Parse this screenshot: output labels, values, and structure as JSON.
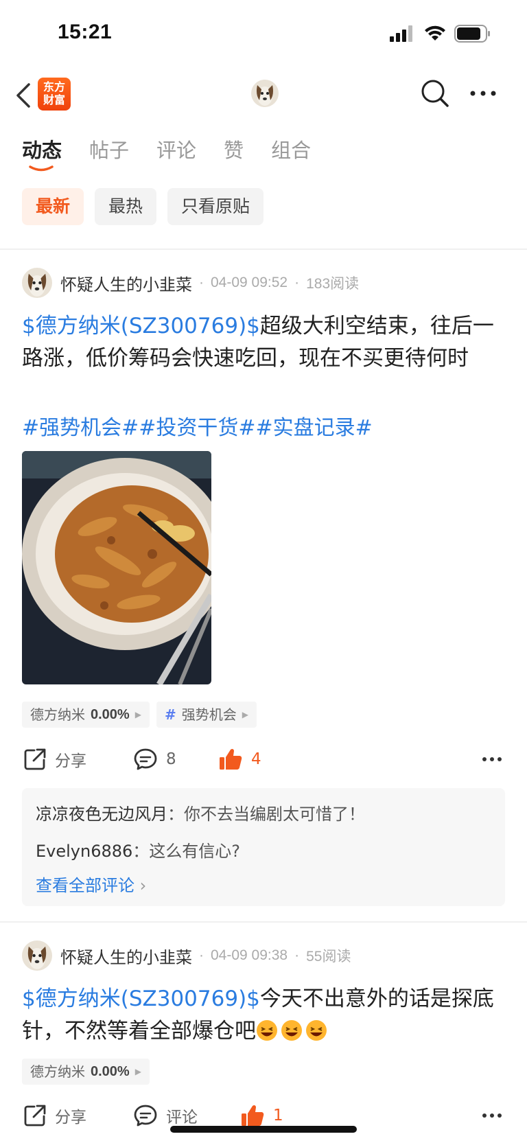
{
  "status_bar": {
    "time": "15:21"
  },
  "header": {
    "brand_logo_line1": "东方",
    "brand_logo_line2": "财富"
  },
  "tabs": [
    {
      "label": "动态",
      "active": true
    },
    {
      "label": "帖子",
      "active": false
    },
    {
      "label": "评论",
      "active": false
    },
    {
      "label": "赞",
      "active": false
    },
    {
      "label": "组合",
      "active": false
    }
  ],
  "filters": [
    {
      "label": "最新",
      "active": true
    },
    {
      "label": "最热",
      "active": false
    },
    {
      "label": "只看原贴",
      "active": false
    }
  ],
  "posts": [
    {
      "author": "怀疑人生的小韭菜",
      "time": "04-09 09:52",
      "reads": "183阅读",
      "stock_link": "$德方纳米(SZ300769)$",
      "body": "超级大利空结束，往后一路涨，低价筹码会快速吃回，现在不买更待何时",
      "topics": "#强势机会##投资干货##实盘记录#",
      "tags": [
        {
          "name": "德方纳米",
          "value": "0.00%"
        },
        {
          "name": "强势机会",
          "hash": "#"
        }
      ],
      "share_label": "分享",
      "comment_count": "8",
      "like_count": "4",
      "comments": [
        {
          "name": "凉凉夜色无边风月",
          "text": "你不去当编剧太可惜了！"
        },
        {
          "name": "Evelyn6886",
          "text": "这么有信心?"
        }
      ],
      "view_all_label": "查看全部评论"
    },
    {
      "author": "怀疑人生的小韭菜",
      "time": "04-09 09:38",
      "reads": "55阅读",
      "stock_link": "$德方纳米(SZ300769)$",
      "body": "今天不出意外的话是探底针，不然等着全部爆仓吧",
      "tags": [
        {
          "name": "德方纳米",
          "value": "0.00%"
        }
      ],
      "share_label": "分享",
      "comment_label": "评论",
      "like_count": "1"
    }
  ],
  "colors": {
    "accent": "#f25a1e",
    "link": "#2a7ce0"
  }
}
